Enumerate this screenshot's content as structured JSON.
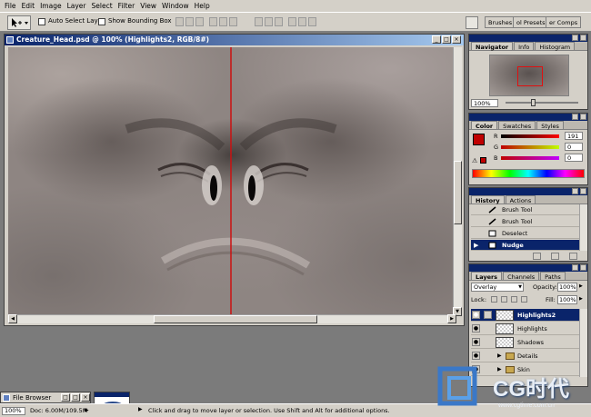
{
  "menu": [
    "File",
    "Edit",
    "Image",
    "Layer",
    "Select",
    "Filter",
    "View",
    "Window",
    "Help"
  ],
  "options": {
    "auto_select_layer": "Auto Select Layer",
    "show_bounding_box": "Show Bounding Box"
  },
  "palette_well": [
    "Brushes",
    "ol Presets",
    "er Comps"
  ],
  "document": {
    "title": "Creature_Head.psd @ 100% (Highlights2, RGB/8#)"
  },
  "navigator": {
    "tabs": [
      "Navigator",
      "Info",
      "Histogram"
    ],
    "zoom": "100%"
  },
  "color": {
    "tabs": [
      "Color",
      "Swatches",
      "Styles"
    ],
    "channels": [
      {
        "label": "R",
        "value": "191"
      },
      {
        "label": "G",
        "value": "0"
      },
      {
        "label": "B",
        "value": "0"
      }
    ],
    "foreground": "#bf0000"
  },
  "history": {
    "tabs": [
      "History",
      "Actions"
    ],
    "items": [
      "Brush Tool",
      "Brush Tool",
      "Deselect",
      "Nudge"
    ]
  },
  "layers": {
    "tabs": [
      "Layers",
      "Channels",
      "Paths"
    ],
    "blend_mode": "Overlay",
    "opacity_label": "Opacity:",
    "opacity": "100%",
    "lock_label": "Lock:",
    "fill_label": "Fill:",
    "fill": "100%",
    "items": [
      "Highlights2",
      "Highlights",
      "Shadows",
      "Details",
      "Skin"
    ]
  },
  "file_browser": {
    "label": "File Browser"
  },
  "status": {
    "zoom": "100%",
    "doc": "Doc: 6.00M/109.5M",
    "hint": "Click and drag to move layer or selection.  Use Shift and Alt for additional options."
  },
  "watermark": {
    "text": "CG时代",
    "url": "www.cgtime.com.cn"
  }
}
